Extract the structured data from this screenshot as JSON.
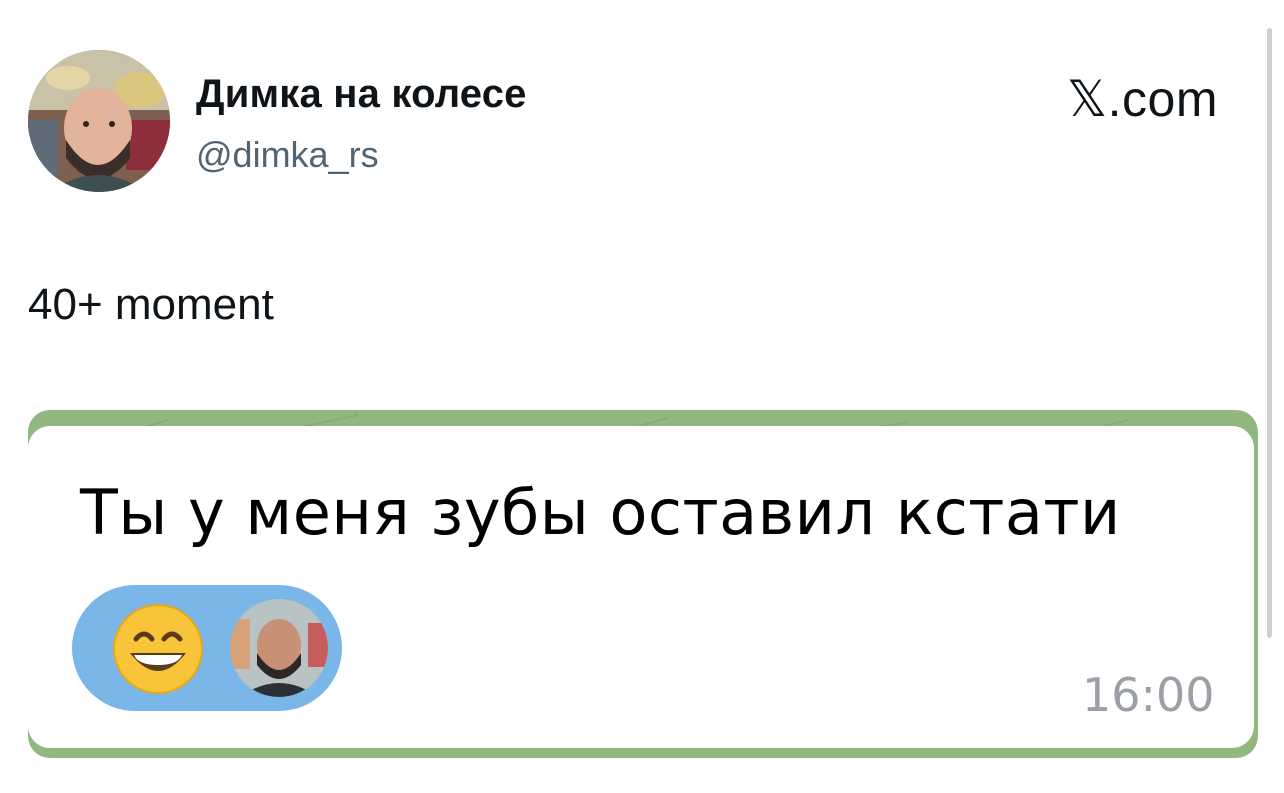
{
  "author": {
    "display_name": "Димка на колесе",
    "handle": "@dimka_rs"
  },
  "brand": "𝕏.com",
  "tweet": {
    "text": "40+ moment"
  },
  "message": {
    "text": "Ты у меня зубы оставил кстати",
    "time": "16:00",
    "reaction_emoji": "grinning-face-with-smiling-eyes"
  },
  "colors": {
    "chat_background": "#92b87f",
    "reaction_pill": "#7ab7e8",
    "timestamp": "#9aa0a5",
    "handle": "#536471"
  }
}
